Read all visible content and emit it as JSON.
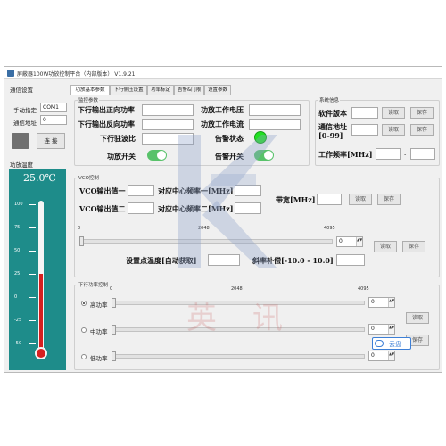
{
  "title": "屏蔽器100W功放控制平台（内部版本） V1.9.21",
  "left": {
    "comm_section": "通信设置",
    "manual_label": "手动指定",
    "com_value": "COM1",
    "addr_label": "通信地址",
    "addr_value": "0",
    "connect_label": "连 接",
    "temp_section": "功放温度",
    "temp_value": "25.0℃",
    "scale": [
      "100",
      "75",
      "50",
      "25",
      "0",
      "-25",
      "-50"
    ],
    "temp_level": "25.0"
  },
  "tabs": [
    "功放基本参数",
    "下行侧压设置",
    "功率标定",
    "告警&门限",
    "设置参数"
  ],
  "monitor": {
    "section": "监控参数",
    "fwd_power": "下行输出正向功率",
    "rev_power": "下行输出反向功率",
    "vswr": "下行驻波比",
    "pa_switch": "功放开关",
    "pa_voltage": "功放工作电压",
    "pa_current": "功放工作电流",
    "alarm_status": "告警状态",
    "alarm_switch": "告警开关"
  },
  "sysinfo": {
    "section": "系统信息",
    "sw_version": "软件版本",
    "comm_addr": "通信地址",
    "range": "[0-99]",
    "read": "读取",
    "save": "保存",
    "freq": "工作频率[MHz]",
    "dash": "-"
  },
  "vco": {
    "section": "VCO控制",
    "out1": "VCO输出值一",
    "out2": "VCO输出值二",
    "center1": "对应中心频率一[MHz]",
    "center2": "对应中心频率二[MHz]",
    "bandwidth": "带宽[MHz]",
    "read": "读取",
    "save": "保存",
    "ticks": [
      "0",
      "2048",
      "4095"
    ],
    "spin": "0",
    "set_temp": "设置点温度[自动获取]",
    "slope": "斜率补偿[-10.0 - 10.0]"
  },
  "power": {
    "section": "下行功率控制",
    "ticks": [
      "0",
      "2048",
      "4095"
    ],
    "rows": [
      {
        "label": "高功率",
        "spin": "0"
      },
      {
        "label": "中功率",
        "spin": "0"
      },
      {
        "label": "低功率",
        "spin": "0"
      }
    ],
    "read": "读取",
    "save": "保存"
  },
  "cloud_badge": "云盘",
  "watermark": [
    "英",
    "讯"
  ],
  "colors": {
    "alarm": "#22e022",
    "toggle": "#58c26a",
    "thermo_bg": "#1e8c8a",
    "mercury": "#d62020"
  }
}
